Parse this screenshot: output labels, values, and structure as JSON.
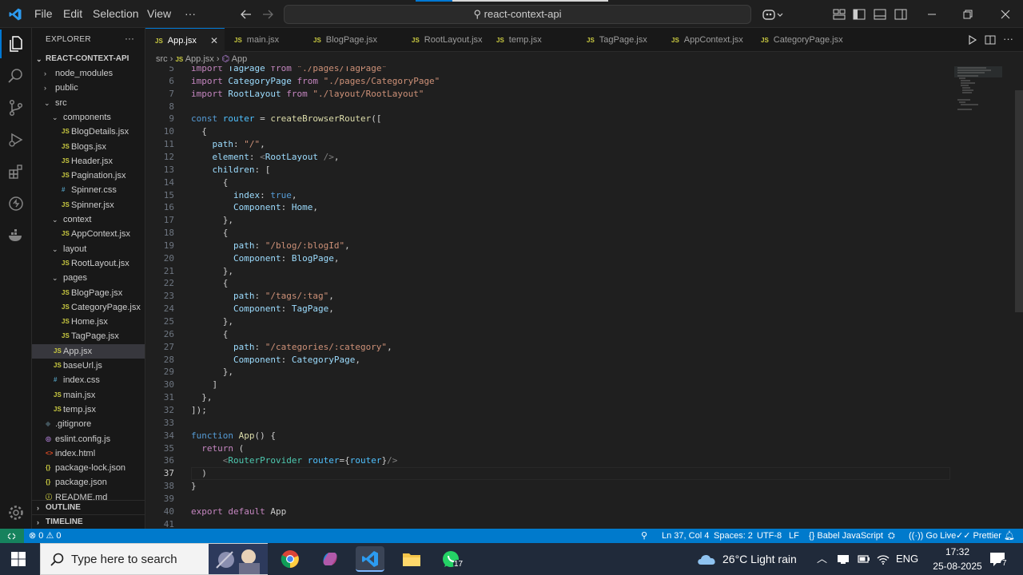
{
  "titlebar": {
    "menu": [
      "File",
      "Edit",
      "Selection",
      "View"
    ],
    "more": "···",
    "search": "react-context-api"
  },
  "explorer": {
    "header": "EXPLORER",
    "more": "···",
    "root": "REACT-CONTEXT-API",
    "tree": [
      {
        "name": "node_modules",
        "type": "folder",
        "indent": 1,
        "open": false
      },
      {
        "name": "public",
        "type": "folder",
        "indent": 1,
        "open": false
      },
      {
        "name": "src",
        "type": "folder",
        "indent": 1,
        "open": true
      },
      {
        "name": "components",
        "type": "folder",
        "indent": 2,
        "open": true
      },
      {
        "name": "BlogDetails.jsx",
        "type": "js",
        "indent": 3
      },
      {
        "name": "Blogs.jsx",
        "type": "js",
        "indent": 3
      },
      {
        "name": "Header.jsx",
        "type": "js",
        "indent": 3
      },
      {
        "name": "Pagination.jsx",
        "type": "js",
        "indent": 3
      },
      {
        "name": "Spinner.css",
        "type": "css",
        "indent": 3
      },
      {
        "name": "Spinner.jsx",
        "type": "js",
        "indent": 3
      },
      {
        "name": "context",
        "type": "folder",
        "indent": 2,
        "open": true
      },
      {
        "name": "AppContext.jsx",
        "type": "js",
        "indent": 3
      },
      {
        "name": "layout",
        "type": "folder",
        "indent": 2,
        "open": true
      },
      {
        "name": "RootLayout.jsx",
        "type": "js",
        "indent": 3
      },
      {
        "name": "pages",
        "type": "folder",
        "indent": 2,
        "open": true
      },
      {
        "name": "BlogPage.jsx",
        "type": "js",
        "indent": 3
      },
      {
        "name": "CategoryPage.jsx",
        "type": "js",
        "indent": 3
      },
      {
        "name": "Home.jsx",
        "type": "js",
        "indent": 3
      },
      {
        "name": "TagPage.jsx",
        "type": "js",
        "indent": 3
      },
      {
        "name": "App.jsx",
        "type": "js",
        "indent": 2,
        "selected": true
      },
      {
        "name": "baseUrl.js",
        "type": "js",
        "indent": 2
      },
      {
        "name": "index.css",
        "type": "css",
        "indent": 2
      },
      {
        "name": "main.jsx",
        "type": "js",
        "indent": 2
      },
      {
        "name": "temp.jsx",
        "type": "js",
        "indent": 2
      },
      {
        "name": ".gitignore",
        "type": "git",
        "indent": 1
      },
      {
        "name": "eslint.config.js",
        "type": "eslint",
        "indent": 1
      },
      {
        "name": "index.html",
        "type": "html",
        "indent": 1
      },
      {
        "name": "package-lock.json",
        "type": "json",
        "indent": 1
      },
      {
        "name": "package.json",
        "type": "json",
        "indent": 1
      },
      {
        "name": "README.md",
        "type": "md",
        "indent": 1
      }
    ],
    "outline": "OUTLINE",
    "timeline": "TIMELINE"
  },
  "tabs": [
    {
      "label": "App.jsx",
      "active": true
    },
    {
      "label": "main.jsx"
    },
    {
      "label": "BlogPage.jsx"
    },
    {
      "label": "RootLayout.jsx"
    },
    {
      "label": "temp.jsx"
    },
    {
      "label": "TagPage.jsx"
    },
    {
      "label": "AppContext.jsx"
    },
    {
      "label": "CategoryPage.jsx"
    }
  ],
  "breadcrumbs": {
    "folder": "src",
    "file": "App.jsx",
    "symbol": "App"
  },
  "code": [
    {
      "n": 5,
      "t": "import TagPage from \"./pages/TagPage\""
    },
    {
      "n": 6,
      "t": "import CategoryPage from \"./pages/CategoryPage\""
    },
    {
      "n": 7,
      "t": "import RootLayout from \"./layout/RootLayout\""
    },
    {
      "n": 8,
      "t": ""
    },
    {
      "n": 9,
      "t": "const router = createBrowserRouter(["
    },
    {
      "n": 10,
      "t": "  {"
    },
    {
      "n": 11,
      "t": "    path: \"/\","
    },
    {
      "n": 12,
      "t": "    element: <RootLayout />,"
    },
    {
      "n": 13,
      "t": "    children: ["
    },
    {
      "n": 14,
      "t": "      {"
    },
    {
      "n": 15,
      "t": "        index: true,"
    },
    {
      "n": 16,
      "t": "        Component: Home,"
    },
    {
      "n": 17,
      "t": "      },"
    },
    {
      "n": 18,
      "t": "      {"
    },
    {
      "n": 19,
      "t": "        path: \"/blog/:blogId\","
    },
    {
      "n": 20,
      "t": "        Component: BlogPage,"
    },
    {
      "n": 21,
      "t": "      },"
    },
    {
      "n": 22,
      "t": "      {"
    },
    {
      "n": 23,
      "t": "        path: \"/tags/:tag\","
    },
    {
      "n": 24,
      "t": "        Component: TagPage,"
    },
    {
      "n": 25,
      "t": "      },"
    },
    {
      "n": 26,
      "t": "      {"
    },
    {
      "n": 27,
      "t": "        path: \"/categories/:category\","
    },
    {
      "n": 28,
      "t": "        Component: CategoryPage,"
    },
    {
      "n": 29,
      "t": "      },"
    },
    {
      "n": 30,
      "t": "    ]"
    },
    {
      "n": 31,
      "t": "  },"
    },
    {
      "n": 32,
      "t": "]);"
    },
    {
      "n": 33,
      "t": ""
    },
    {
      "n": 34,
      "t": "function App() {"
    },
    {
      "n": 35,
      "t": "  return ("
    },
    {
      "n": 36,
      "t": "      <RouterProvider router={router}/>"
    },
    {
      "n": 37,
      "t": "  )"
    },
    {
      "n": 38,
      "t": "}"
    },
    {
      "n": 39,
      "t": ""
    },
    {
      "n": 40,
      "t": "export default App"
    },
    {
      "n": 41,
      "t": ""
    }
  ],
  "status": {
    "errors": "0",
    "warnings": "0",
    "position": "Ln 37, Col 4",
    "spaces": "Spaces: 2",
    "encoding": "UTF-8",
    "eol": "LF",
    "language": "Babel JavaScript",
    "golive": "Go Live",
    "prettier": "Prettier"
  },
  "taskbar": {
    "search_placeholder": "Type here to search",
    "weather": "26°C  Light rain",
    "lang": "ENG",
    "time": "17:32",
    "date": "25-08-2025",
    "notifications": "7",
    "whatsapp_badge": "17"
  },
  "colors": {
    "accent": "#0078d4",
    "status": "#007acc"
  }
}
